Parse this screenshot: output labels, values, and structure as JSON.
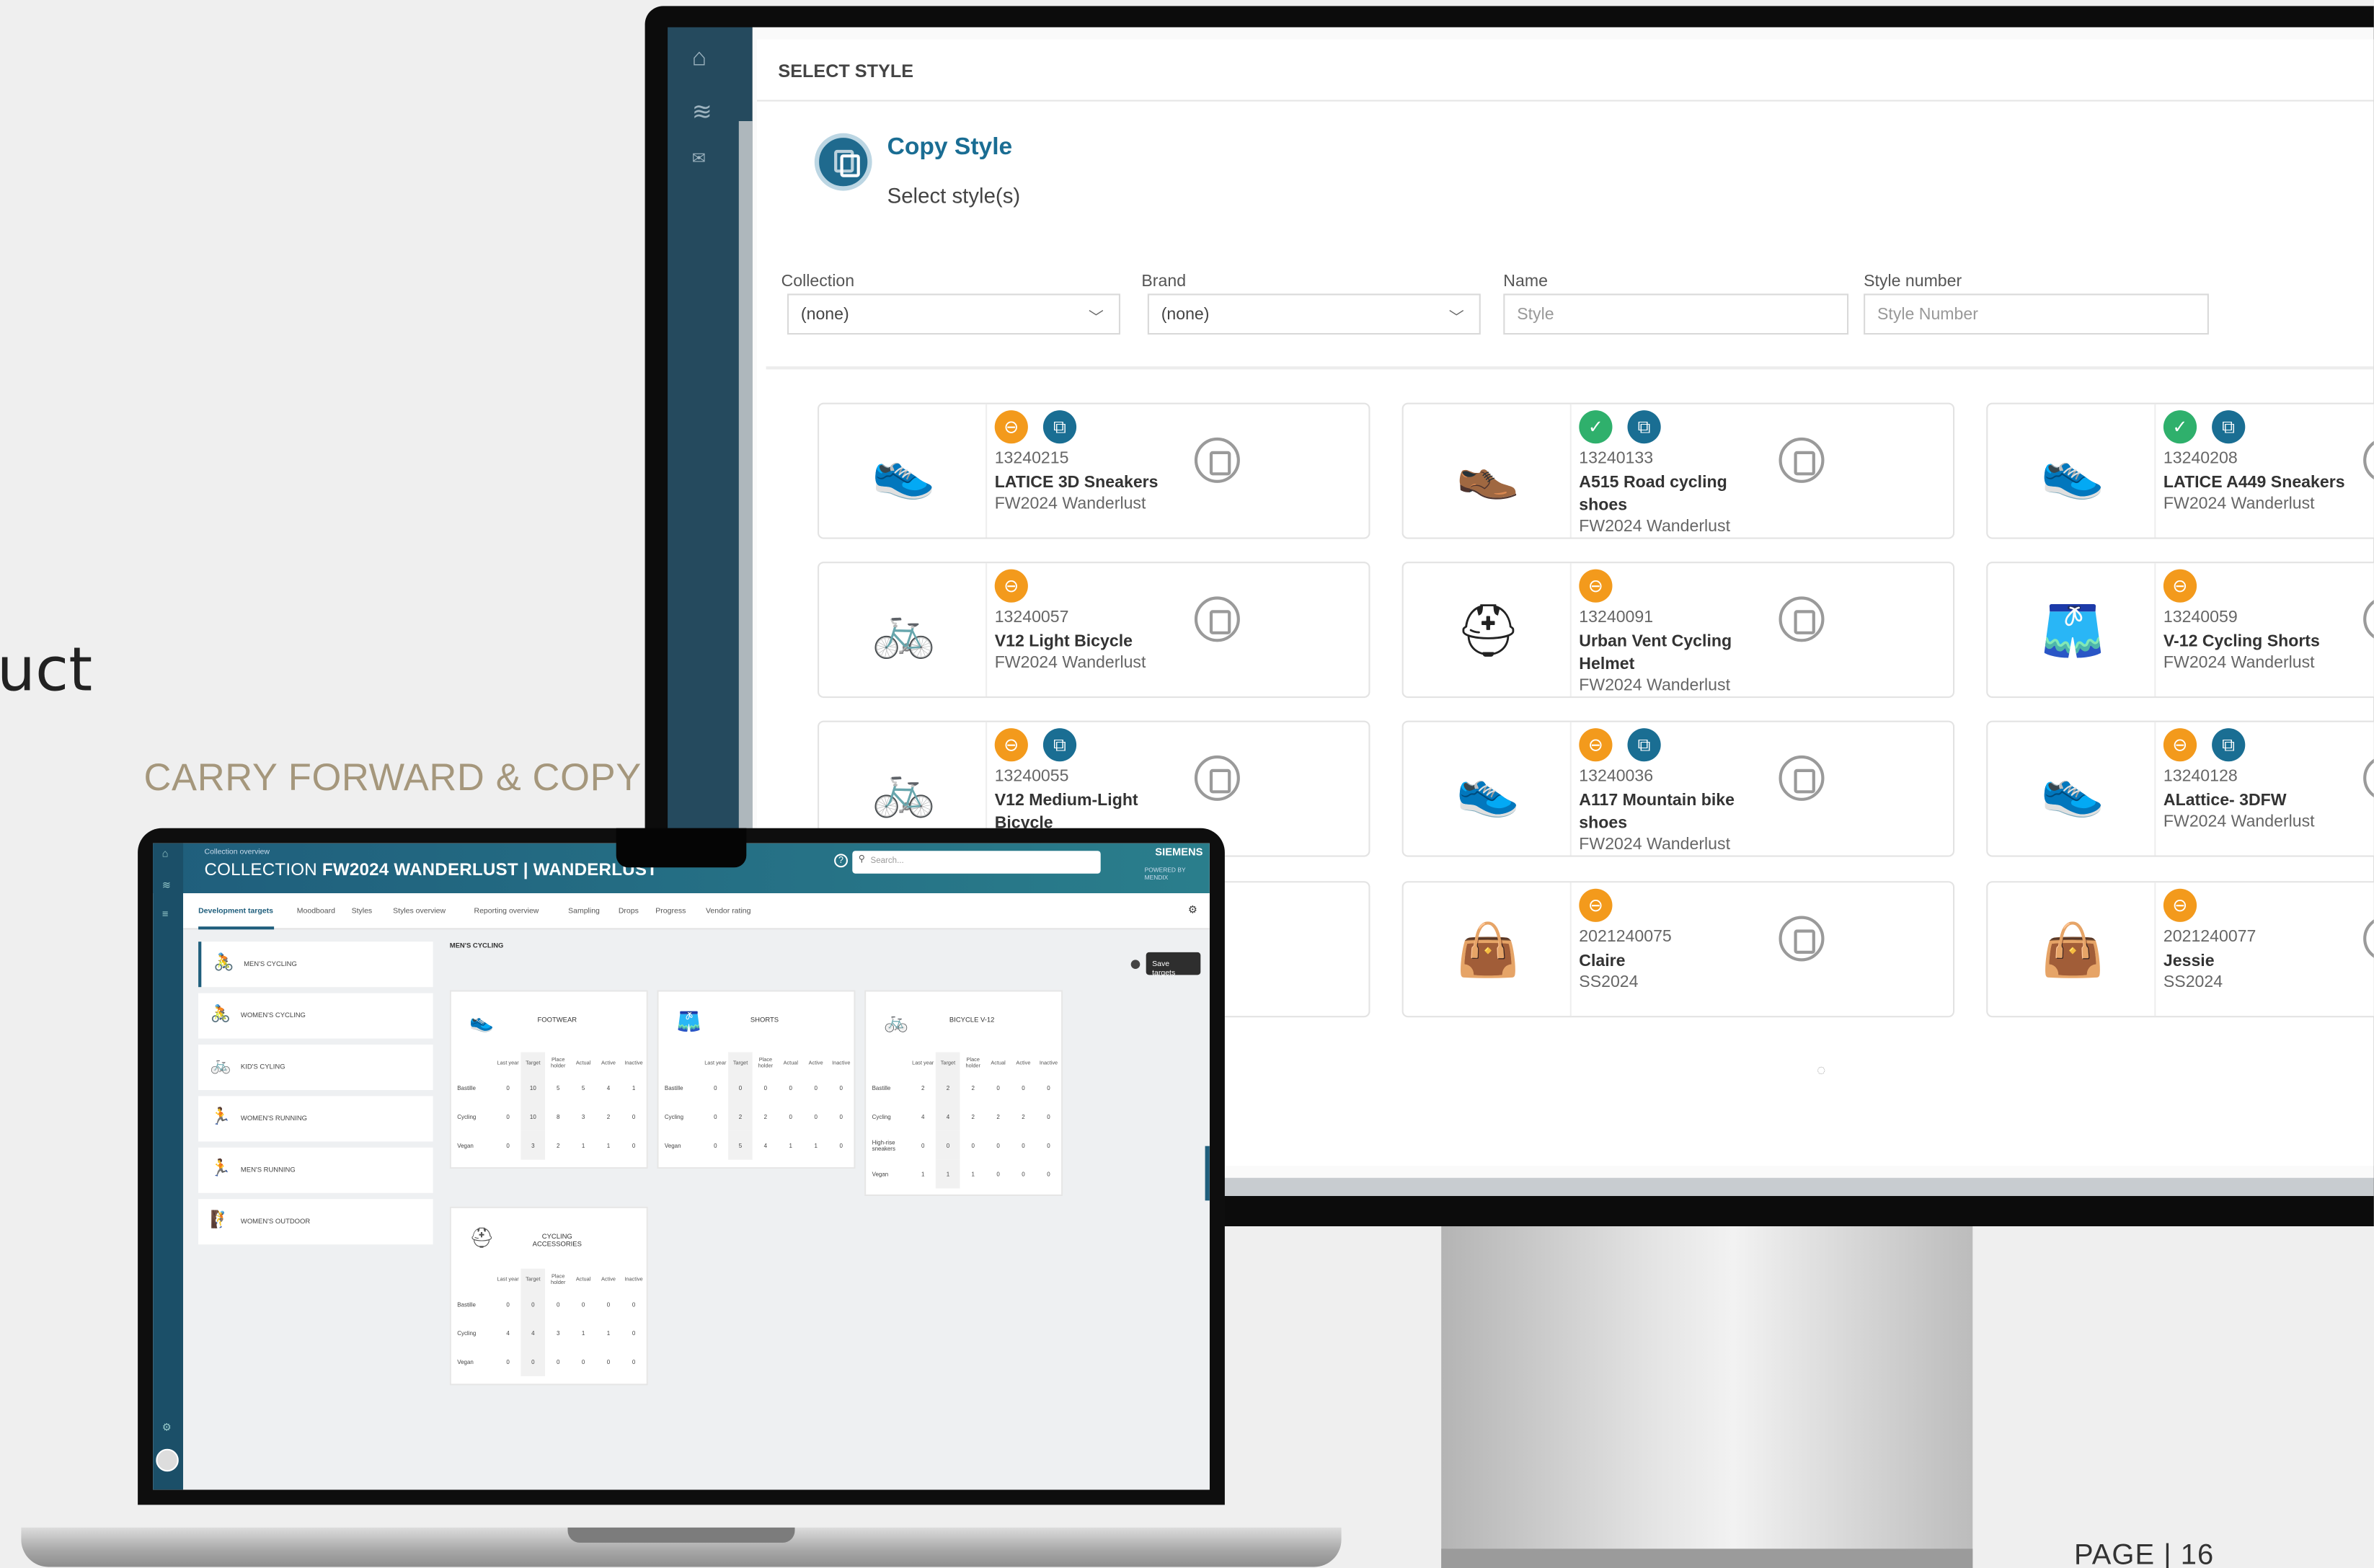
{
  "page": {
    "fragment_left": "uct",
    "section_title": "CARRY FORWARD & COPY",
    "page_number": "PAGE | 16"
  },
  "monitor": {
    "dialog": {
      "title": "SELECT STYLE",
      "heading": "Copy Style",
      "subheading": "Select style(s)",
      "filters": {
        "collection": {
          "label": "Collection",
          "value": "(none)"
        },
        "brand": {
          "label": "Brand",
          "value": "(none)"
        },
        "name": {
          "label": "Name",
          "placeholder": "Style"
        },
        "style_number": {
          "label": "Style number",
          "placeholder": "Style Number"
        }
      },
      "cards": [
        {
          "number": "13240215",
          "name": "LATICE 3D Sneakers",
          "collection": "FW2024 Wanderlust",
          "statuses": [
            "orange",
            "blue"
          ],
          "image": "sneaker-blue"
        },
        {
          "number": "13240133",
          "name": "A515 Road cycling shoes",
          "collection": "FW2024 Wanderlust",
          "statuses": [
            "green",
            "blue"
          ],
          "image": "cycling-shoe"
        },
        {
          "number": "13240208",
          "name": "LATICE A449 Sneakers",
          "collection": "FW2024 Wanderlust",
          "statuses": [
            "green",
            "blue"
          ],
          "image": "sneaker-green"
        },
        {
          "number": "13240057",
          "name": "V12 Light Bicycle",
          "collection": "FW2024 Wanderlust",
          "statuses": [
            "orange"
          ],
          "image": "bicycle"
        },
        {
          "number": "13240091",
          "name": "Urban Vent Cycling Helmet",
          "collection": "FW2024 Wanderlust",
          "statuses": [
            "orange"
          ],
          "image": "helmet"
        },
        {
          "number": "13240059",
          "name": "V-12 Cycling Shorts",
          "collection": "FW2024 Wanderlust",
          "statuses": [
            "orange"
          ],
          "image": "bib-shorts"
        },
        {
          "number": "13240055",
          "name": "V12 Medium-Light Bicycle",
          "collection": "",
          "statuses": [
            "orange",
            "blue"
          ],
          "image": "bicycle-purple"
        },
        {
          "number": "13240036",
          "name": "A117 Mountain bike shoes",
          "collection": "FW2024 Wanderlust",
          "statuses": [
            "orange",
            "blue"
          ],
          "image": "mtb-shoes"
        },
        {
          "number": "13240128",
          "name": "ALattice- 3DFW",
          "collection": "FW2024 Wanderlust",
          "statuses": [
            "orange",
            "blue"
          ],
          "image": "sneaker-grey"
        },
        {
          "number": "2021240075",
          "name": "Claire",
          "collection": "SS2024",
          "statuses": [
            "orange"
          ],
          "image": "bag-green"
        },
        {
          "number": "2021240077",
          "name": "Jessie",
          "collection": "SS2024",
          "statuses": [
            "orange"
          ],
          "image": "bag-brown"
        }
      ]
    }
  },
  "laptop": {
    "breadcrumb": "Collection overview",
    "title_prefix": "COLLECTION",
    "title_main": "FW2024 WANDERLUST | WANDERLUST",
    "search_placeholder": "Search...",
    "brand": "SIEMENS",
    "brand_sub": "POWERED BY MENDIX",
    "tabs": [
      "Development targets",
      "Moodboard",
      "Styles",
      "Styles overview",
      "Reporting overview",
      "Sampling",
      "Drops",
      "Progress",
      "Vendor rating"
    ],
    "section": "MEN'S CYCLING",
    "save_button": "Save targets",
    "nav": [
      "MEN'S CYCLING",
      "WOMEN'S CYCLING",
      "KID'S CYLING",
      "WOMEN'S RUNNING",
      "MEN'S RUNNING",
      "WOMEN'S OUTDOOR"
    ],
    "columns": [
      "",
      "Last year",
      "Target",
      "Place holder",
      "Actual",
      "Active",
      "Inactive"
    ],
    "cards": [
      {
        "title": "FOOTWEAR",
        "rows": [
          [
            "Bastille",
            "0",
            "10",
            "5",
            "5",
            "4",
            "1"
          ],
          [
            "Cycling",
            "0",
            "10",
            "8",
            "3",
            "2",
            "0"
          ],
          [
            "Vegan",
            "0",
            "3",
            "2",
            "1",
            "1",
            "0"
          ]
        ]
      },
      {
        "title": "SHORTS",
        "rows": [
          [
            "Bastille",
            "0",
            "0",
            "0",
            "0",
            "0",
            "0"
          ],
          [
            "Cycling",
            "0",
            "2",
            "2",
            "0",
            "0",
            "0"
          ],
          [
            "Vegan",
            "0",
            "5",
            "4",
            "1",
            "1",
            "0"
          ]
        ]
      },
      {
        "title": "BICYCLE V-12",
        "rows": [
          [
            "Bastille",
            "2",
            "2",
            "2",
            "0",
            "0",
            "0"
          ],
          [
            "Cycling",
            "4",
            "4",
            "2",
            "2",
            "2",
            "0"
          ],
          [
            "High-rise sneakers",
            "0",
            "0",
            "0",
            "0",
            "0",
            "0"
          ],
          [
            "Vegan",
            "1",
            "1",
            "1",
            "0",
            "0",
            "0"
          ]
        ]
      },
      {
        "title": "CYCLING ACCESSORIES",
        "rows": [
          [
            "Bastille",
            "0",
            "0",
            "0",
            "0",
            "0",
            "0"
          ],
          [
            "Cycling",
            "4",
            "4",
            "3",
            "1",
            "1",
            "0"
          ],
          [
            "Vegan",
            "0",
            "0",
            "0",
            "0",
            "0",
            "0"
          ]
        ]
      }
    ]
  },
  "colors": {
    "accent": "#1a6d93",
    "status_orange": "#f39a1c",
    "status_green": "#2fb06c",
    "section_title": "#a5977c"
  }
}
